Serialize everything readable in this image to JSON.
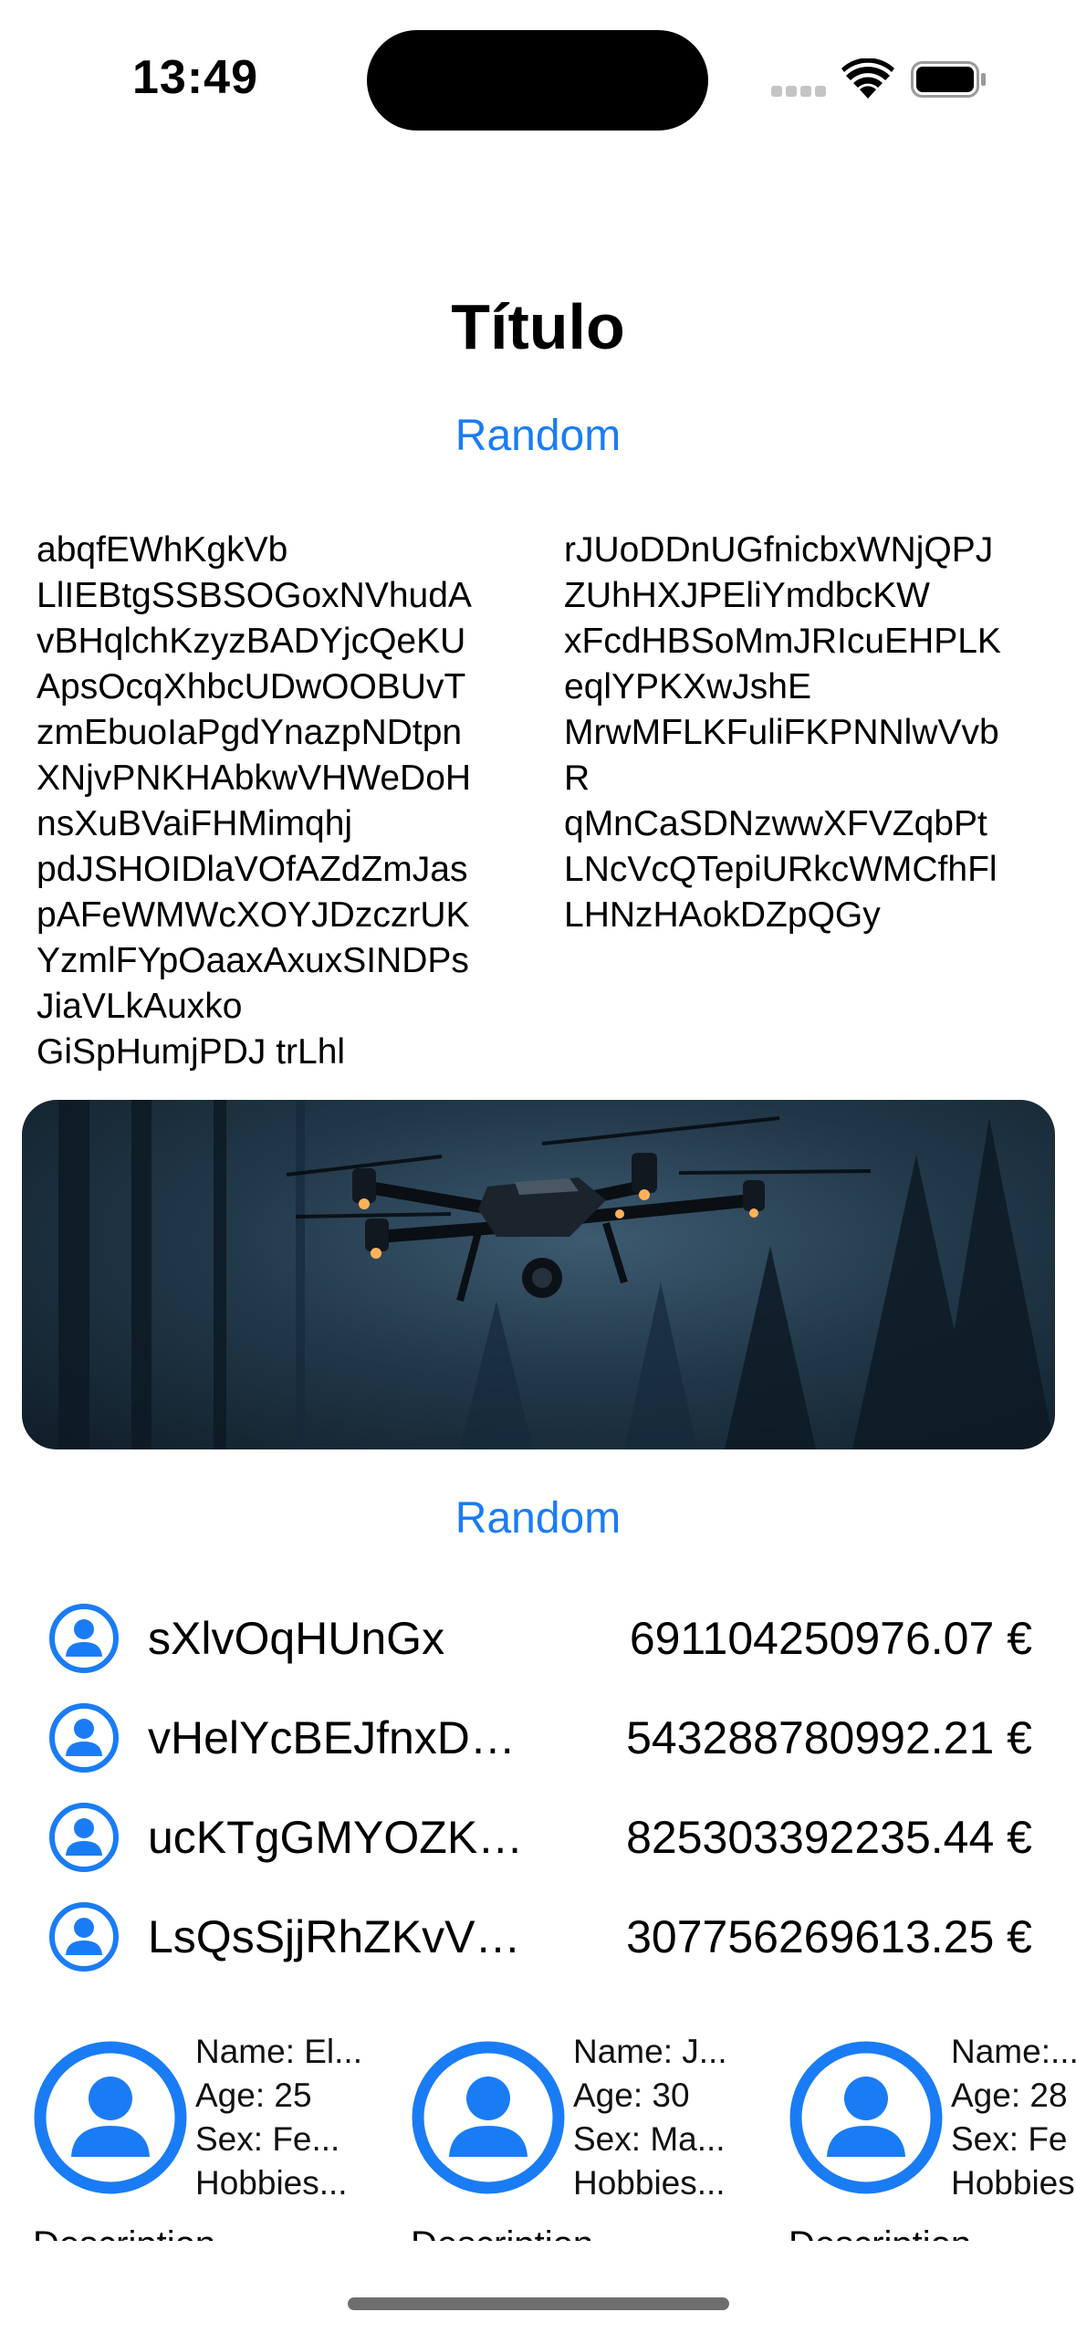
{
  "status_bar": {
    "time": "13:49"
  },
  "header": {
    "title": "Título"
  },
  "buttons": {
    "random_top": "Random",
    "random_bottom": "Random"
  },
  "text_columns": {
    "left": [
      "abqfEWhKgkVb",
      "LlIEBtgSSBSOGoxNVhudA",
      "vBHqlchKzyzBADYjcQeKU",
      "ApsOcqXhbcUDwOOBUvT",
      "zmEbuoIaPgdYnazpNDtpn",
      "XNjvPNKHAbkwVHWeDoH",
      "nsXuBVaiFHMimqhj",
      "pdJSHOIDlaVOfAZdZmJas",
      "pAFeWMWcXOYJDzczrUK",
      "YzmlFYpOaaxAxuxSINDPs",
      "JiaVLkAuxko",
      "GiSpHumjPDJ trLhl"
    ],
    "right": [
      "rJUoDDnUGfnicbxWNjQPJ",
      "ZUhHXJPEliYmdbcKW",
      "xFcdHBSoMmJRIcuEHPLK",
      "eqlYPKXwJshE",
      "MrwMFLKFuliFKPNNlwVvb",
      "R",
      "qMnCaSDNzwwXFVZqbPt",
      "LNcVcQTepiURkcWMCfhFl",
      "LHNzHAokDZpQGy"
    ]
  },
  "transactions": [
    {
      "name": "sXlvOqHUnGx",
      "amount": "691104250976.07 €"
    },
    {
      "name": "vHelYcBEJfnxDG...",
      "amount": "543288780992.21 €"
    },
    {
      "name": "ucKTgGMYOZKC...",
      "amount": "825303392235.44 €"
    },
    {
      "name": "LsQsSjjRhZKvVX...",
      "amount": "307756269613.25 €"
    }
  ],
  "people": [
    {
      "name": "Name: El...",
      "age": "Age: 25",
      "sex": "Sex: Fe...",
      "hobbies": "Hobbies...",
      "description": "Description"
    },
    {
      "name": "Name: J...",
      "age": "Age: 30",
      "sex": "Sex: Ma...",
      "hobbies": "Hobbies...",
      "description": "Description"
    },
    {
      "name": "Name:...",
      "age": "Age: 28",
      "sex": "Sex: Fe",
      "hobbies": "Hobbies",
      "description": "Description"
    }
  ],
  "icons": {
    "avatar": "person-circle-icon",
    "hero": "drone-photo"
  },
  "colors": {
    "accent": "#1a7cf5"
  }
}
